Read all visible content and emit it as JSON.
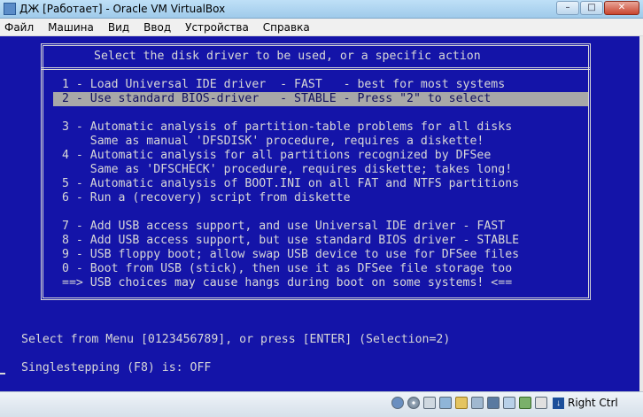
{
  "window": {
    "title": "ДЖ [Работает] - Oracle VM VirtualBox",
    "minimize_glyph": "–",
    "maximize_glyph": "□",
    "close_glyph": "✕"
  },
  "menubar": {
    "items": [
      "Файл",
      "Машина",
      "Вид",
      "Ввод",
      "Устройства",
      "Справка"
    ]
  },
  "screen": {
    "header": "Select the disk driver to be used, or a specific action",
    "menu_lines": [
      "1 - Load Universal IDE driver  - FAST   - best for most systems",
      "2 - Use standard BIOS-driver   - STABLE - Press \"2\" to select",
      "3 - Automatic analysis of partition-table problems for all disks",
      "    Same as manual 'DFSDISK' procedure, requires a diskette!",
      "4 - Automatic analysis for all partitions recognized by DFSee",
      "    Same as 'DFSCHECK' procedure, requires diskette; takes long!",
      "5 - Automatic analysis of BOOT.INI on all FAT and NTFS partitions",
      "6 - Run a (recovery) script from diskette",
      "7 - Add USB access support, and use Universal IDE driver - FAST",
      "8 - Add USB access support, but use standard BIOS driver - STABLE",
      "9 - USB floppy boot; allow swap USB device to use for DFSee files",
      "0 - Boot from USB (stick), then use it as DFSee file storage too",
      "==> USB choices may cause hangs during boot on some systems! <=="
    ],
    "selected_line": "2 - Use standard BIOS-driver   - STABLE - Press \"2\" to select",
    "prompt": "Select from Menu [0123456789], or press [ENTER] (Selection=2)",
    "singlestep": "Singlestepping (F8) is: OFF"
  },
  "statusbar": {
    "host_key_label": "Right Ctrl",
    "host_key_glyph": "↓",
    "icons": [
      "hard-disk-icon",
      "optical-drive-icon",
      "usb-icon",
      "network-icon",
      "shared-folder-icon",
      "shared-clipboard-icon",
      "display-icon",
      "video-capture-icon",
      "cpu-icon",
      "mouse-integration-icon"
    ]
  },
  "colors": {
    "screen_bg": "#1414a8",
    "screen_text": "#d8d8d8",
    "highlight_bg": "#a8a8a8",
    "highlight_text": "#101060"
  }
}
